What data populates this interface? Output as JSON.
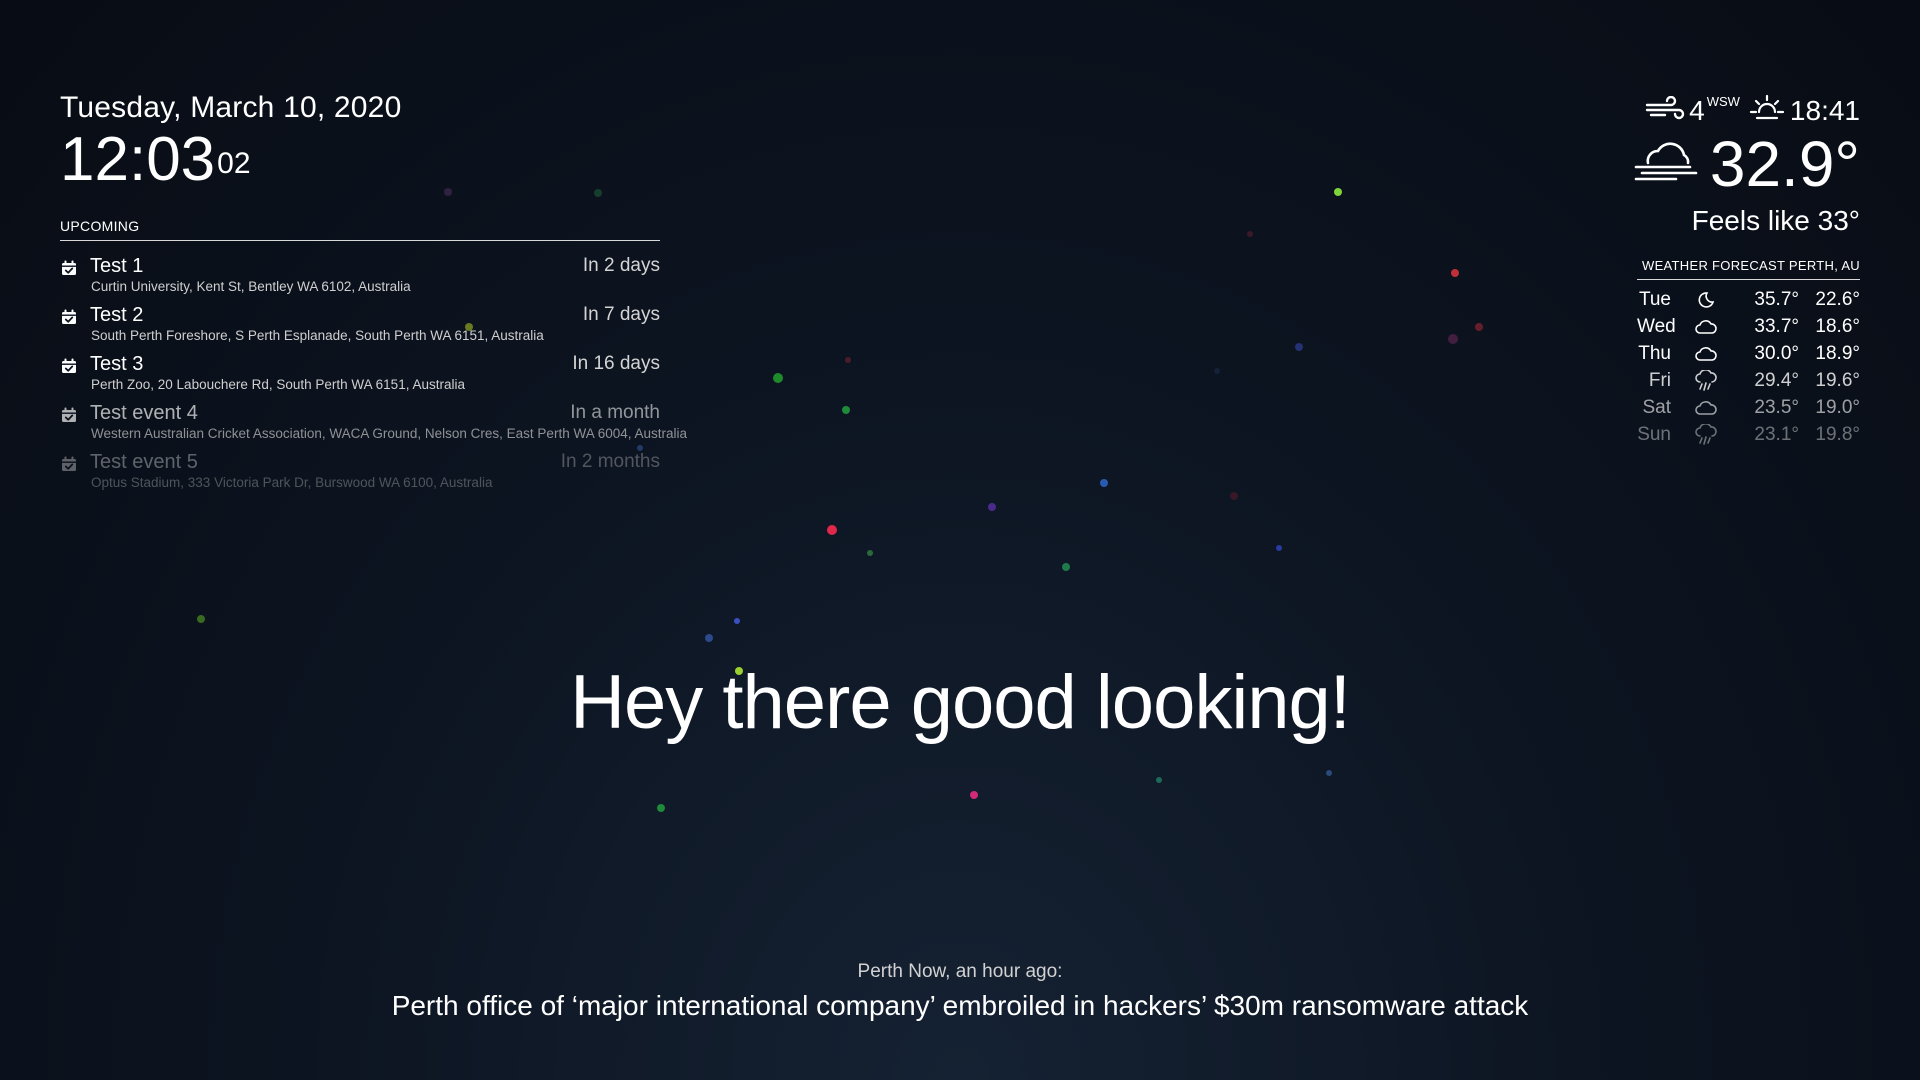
{
  "clock": {
    "date": "Tuesday, March 10, 2020",
    "time": "12:03",
    "seconds": "02"
  },
  "calendar": {
    "header": "UPCOMING",
    "icon": "calendar-check-icon",
    "events": [
      {
        "title": "Test 1",
        "when": "In 2 days",
        "location": "Curtin University, Kent St, Bentley WA 6102, Australia",
        "opacity": 1.0
      },
      {
        "title": "Test 2",
        "when": "In 7 days",
        "location": "South Perth Foreshore, S Perth Esplanade, South Perth WA 6151, Australia",
        "opacity": 1.0
      },
      {
        "title": "Test 3",
        "when": "In 16 days",
        "location": "Perth Zoo, 20 Labouchere Rd, South Perth WA 6151, Australia",
        "opacity": 1.0
      },
      {
        "title": "Test event 4",
        "when": "In a month",
        "location": "Western Australian Cricket Association, WACA Ground, Nelson Cres, East Perth WA 6004, Australia",
        "opacity": 0.67
      },
      {
        "title": "Test event 5",
        "when": "In 2 months",
        "location": "Optus Stadium, 333 Victoria Park Dr, Burswood WA 6100, Australia",
        "opacity": 0.34
      }
    ]
  },
  "current_weather": {
    "wind_speed": "4",
    "wind_direction": "WSW",
    "sun_time": "18:41",
    "temperature": "32.9°",
    "feels_like": "Feels like 33°",
    "icons": {
      "wind": "wind-icon",
      "sunset": "sunset-icon",
      "condition": "cloudy-windy-icon"
    }
  },
  "forecast": {
    "header": "WEATHER FORECAST PERTH, AU",
    "days": [
      {
        "day": "Tue",
        "icon": "night-clear-icon",
        "max": "35.7°",
        "min": "22.6°",
        "opacity": 1.0
      },
      {
        "day": "Wed",
        "icon": "cloudy-icon",
        "max": "33.7°",
        "min": "18.6°",
        "opacity": 1.0
      },
      {
        "day": "Thu",
        "icon": "cloudy-icon",
        "max": "30.0°",
        "min": "18.9°",
        "opacity": 1.0
      },
      {
        "day": "Fri",
        "icon": "rain-icon",
        "max": "29.4°",
        "min": "19.6°",
        "opacity": 0.8
      },
      {
        "day": "Sat",
        "icon": "cloudy-icon",
        "max": "23.5°",
        "min": "19.0°",
        "opacity": 0.6
      },
      {
        "day": "Sun",
        "icon": "rain-icon",
        "max": "23.1°",
        "min": "19.8°",
        "opacity": 0.4
      }
    ]
  },
  "compliment": "Hey there good looking!",
  "news": {
    "source": "Perth Now, an hour ago:",
    "title": "Perth office of ‘major international company’ embroiled in hackers’ $30m ransomware attack"
  }
}
